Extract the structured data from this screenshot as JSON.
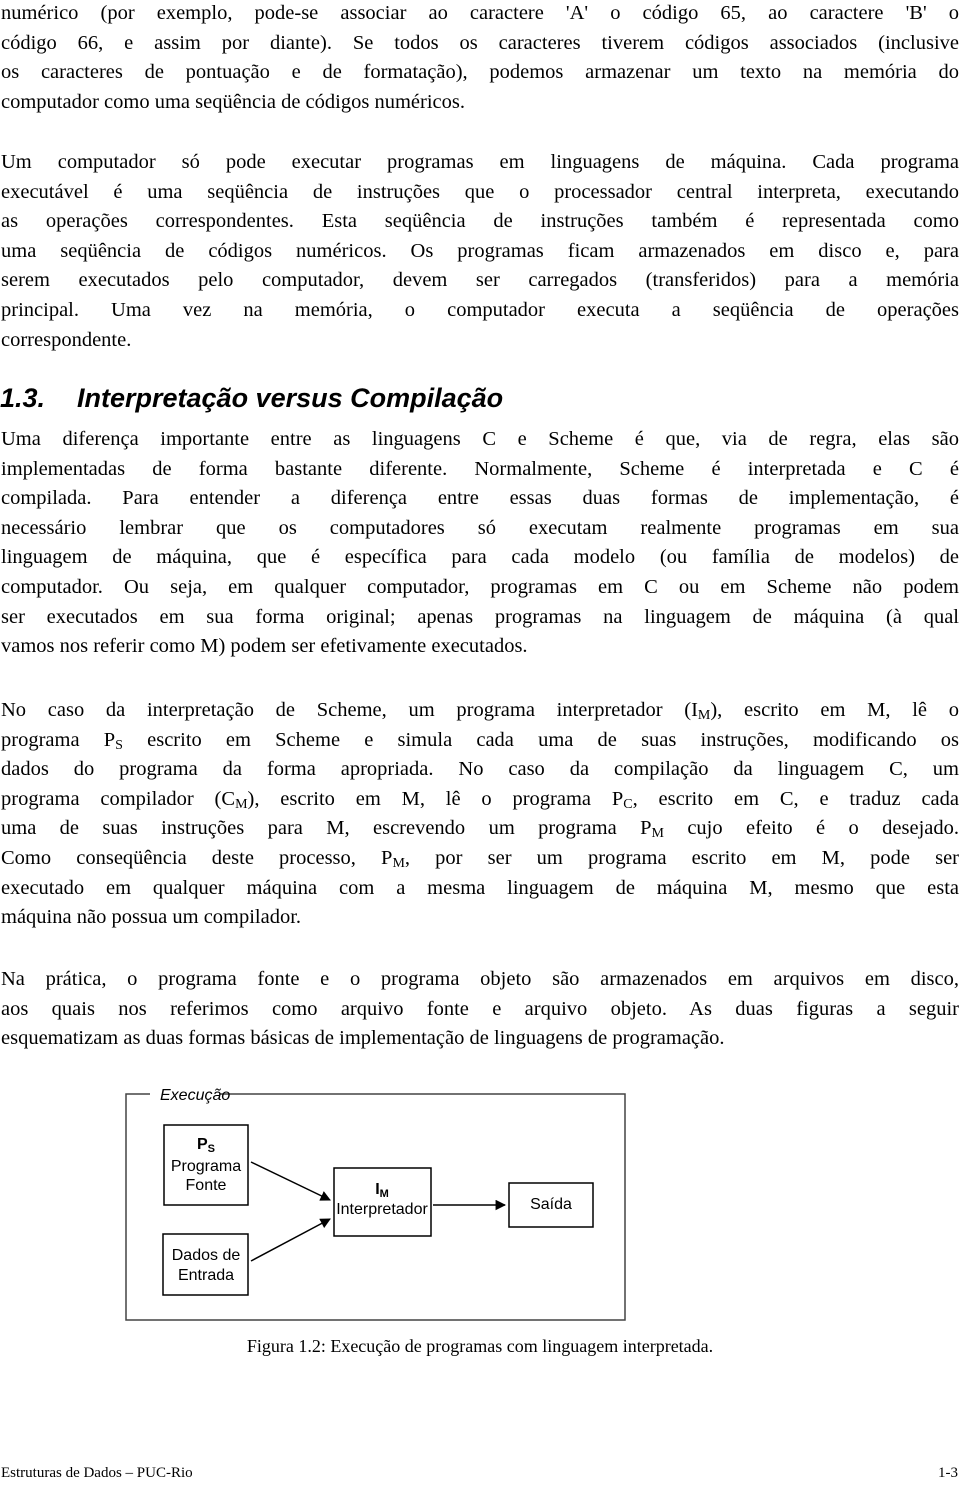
{
  "paragraphs": {
    "p1": [
      "numérico (por exemplo, pode-se associar ao caractere 'A' o código 65, ao caractere 'B' o",
      "código 66, e assim por diante). Se todos os caracteres tiverem códigos associados (inclusive",
      "os caracteres de pontuação e de formatação), podemos armazenar um texto na memória do",
      "computador como uma seqüência de códigos numéricos."
    ],
    "p2": [
      "Um computador só pode executar programas em linguagens de máquina. Cada programa",
      "executável é uma seqüência de instruções que o processador central interpreta, executando",
      "as operações correspondentes. Esta seqüência de instruções também é representada como",
      "uma seqüência de códigos numéricos. Os programas ficam armazenados em disco e, para",
      "serem executados pelo computador, devem ser carregados (transferidos) para a memória",
      "principal. Uma vez na memória, o computador executa a seqüência de operações",
      "correspondente."
    ],
    "p3": [
      "Uma diferença importante entre as linguagens C e Scheme é que, via de regra, elas são",
      "implementadas de forma bastante diferente. Normalmente, Scheme é interpretada e C é",
      "compilada. Para entender a diferença entre essas duas formas de implementação, é",
      "necessário lembrar que os computadores só executam realmente programas em sua",
      "linguagem de máquina, que é específica para cada modelo (ou família de modelos) de",
      "computador. Ou seja, em qualquer computador, programas em C ou em Scheme não podem",
      "ser executados em sua forma original; apenas programas na linguagem de máquina (à qual",
      "vamos nos referir como M) podem ser efetivamente executados."
    ],
    "p4": {
      "l1a": "No caso da interpretação de Scheme, um programa interpretador (I",
      "l1sub": "M",
      "l1b": "), escrito em M, lê o",
      "l2a": "programa P",
      "l2sub": "S",
      "l2b": " escrito em Scheme e simula cada uma de suas instruções, modificando os",
      "l3": "dados do programa da forma apropriada. No caso da compilação da linguagem C, um",
      "l4a": "programa compilador (C",
      "l4sub": "M",
      "l4b": "), escrito em M, lê o programa P",
      "l4sub2": "C",
      "l4c": ", escrito em C, e traduz cada",
      "l5a": "uma de suas instruções para M, escrevendo um programa P",
      "l5sub": "M",
      "l5b": " cujo efeito é o desejado.",
      "l6a": "Como conseqüência deste processo, P",
      "l6sub": "M",
      "l6b": ", por ser um programa escrito em M, pode ser",
      "l7": "executado em qualquer máquina com a mesma linguagem de máquina M, mesmo que esta",
      "l8": "máquina não possua um compilador."
    },
    "p5": [
      "Na prática, o programa fonte e o programa objeto são armazenados em arquivos em disco,",
      "aos quais nos referimos como arquivo fonte e arquivo objeto. As duas figuras a seguir",
      "esquematizam as duas formas básicas de implementação de linguagens de programação."
    ]
  },
  "section": {
    "number": "1.3.",
    "title": "Interpretação versus Compilação"
  },
  "figure": {
    "frame_label": "Execução",
    "source_box": {
      "symbol": "P",
      "subscript": "S",
      "line1": "Programa",
      "line2": "Fonte"
    },
    "input_box": {
      "line1": "Dados de",
      "line2": "Entrada"
    },
    "interpreter_box": {
      "symbol": "I",
      "subscript": "M",
      "line1": "Interpretador"
    },
    "output_box": {
      "line1": "Saída"
    },
    "caption": "Figura 1.2: Execução de programas com linguagem interpretada."
  },
  "footer": {
    "left": "Estruturas de Dados – PUC-Rio",
    "right": "1-3"
  }
}
